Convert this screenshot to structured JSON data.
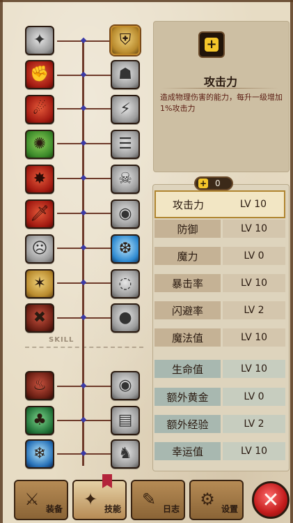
{
  "panel": {
    "attribute_title": "攻击力",
    "attribute_description": "造成物理伤害的能力，每升一级增加1%攻击力",
    "points_value": "0",
    "plus_symbol": "+"
  },
  "divider_text": "SKILL",
  "stats": [
    {
      "label": "攻击力",
      "level": "LV 10",
      "selected": true
    },
    {
      "label": "防御",
      "level": "LV 10"
    },
    {
      "label": "魔力",
      "level": "LV 0"
    },
    {
      "label": "暴击率",
      "level": "LV 10"
    },
    {
      "label": "闪避率",
      "level": "LV 2"
    },
    {
      "label": "魔法值",
      "level": "LV 10"
    },
    {
      "label": "生命值",
      "level": "LV 10"
    },
    {
      "label": "额外黄金",
      "level": "LV 0"
    },
    {
      "label": "额外经验",
      "level": "LV 2"
    },
    {
      "label": "幸运值",
      "level": "LV 10"
    }
  ],
  "bottom_tabs": [
    {
      "label": "装备",
      "icon": "equipment-icon"
    },
    {
      "label": "技能",
      "icon": "skill-icon"
    },
    {
      "label": "日志",
      "icon": "log-icon"
    },
    {
      "label": "设置",
      "icon": "settings-icon"
    }
  ],
  "close_button_symbol": "✕",
  "colors": {
    "parchment": "#e7dcc4",
    "selected_row": "#f2e6c4",
    "gold": "#f4c62a",
    "close_red": "#c21b1b"
  }
}
